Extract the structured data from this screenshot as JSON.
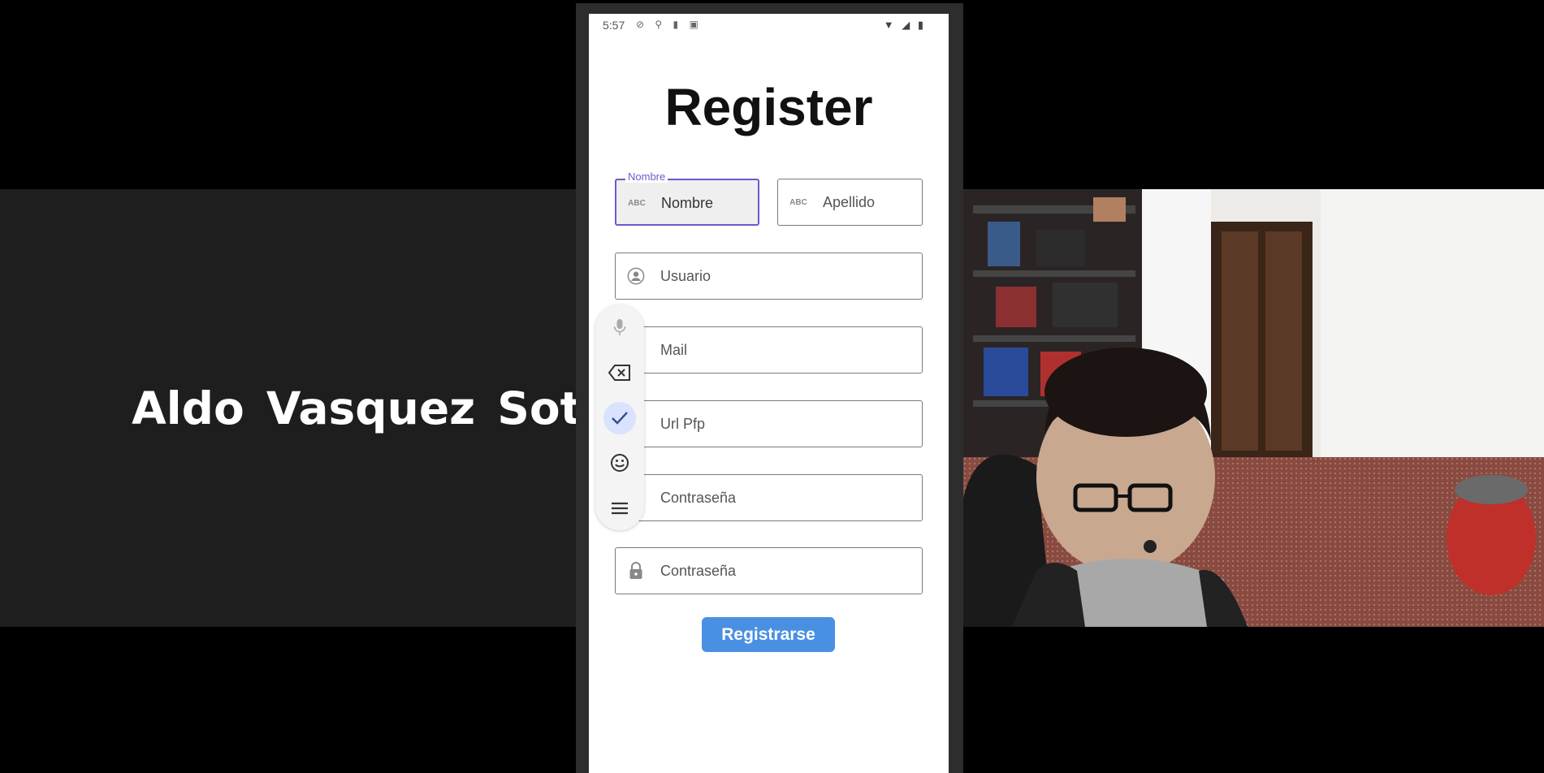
{
  "participant": {
    "name": "Aldo Vasquez Sot."
  },
  "statusbar": {
    "time": "5:57",
    "left_icons": "⊘ ⚲ ▮ ▣",
    "right_icons": "▼ ◢ ▮"
  },
  "app": {
    "title": "Register",
    "fields": {
      "nombre": {
        "label": "Nombre",
        "placeholder": "Nombre",
        "icon": "abc-icon"
      },
      "apellido": {
        "placeholder": "Apellido",
        "icon": "abc-icon"
      },
      "usuario": {
        "placeholder": "Usuario",
        "icon": "account-icon"
      },
      "mail": {
        "placeholder": "Mail",
        "icon": "mail-icon"
      },
      "url_pfp": {
        "placeholder": "Url Pfp",
        "icon": "link-icon"
      },
      "contrasena": {
        "placeholder": "Contraseña",
        "icon": "lock-icon"
      },
      "contrasena2": {
        "placeholder": "Contraseña",
        "icon": "lock-icon"
      }
    },
    "register_button": "Registrarse",
    "abc_glyph": "ABC"
  },
  "keyboard_toolbar": {
    "items": [
      "microphone-icon",
      "backspace-icon",
      "check-icon",
      "emoji-icon",
      "menu-icon"
    ],
    "active": "check-icon"
  },
  "colors": {
    "accent": "#6a5acd",
    "button": "#4a90e2",
    "tile_bg": "#1e1e1e"
  }
}
